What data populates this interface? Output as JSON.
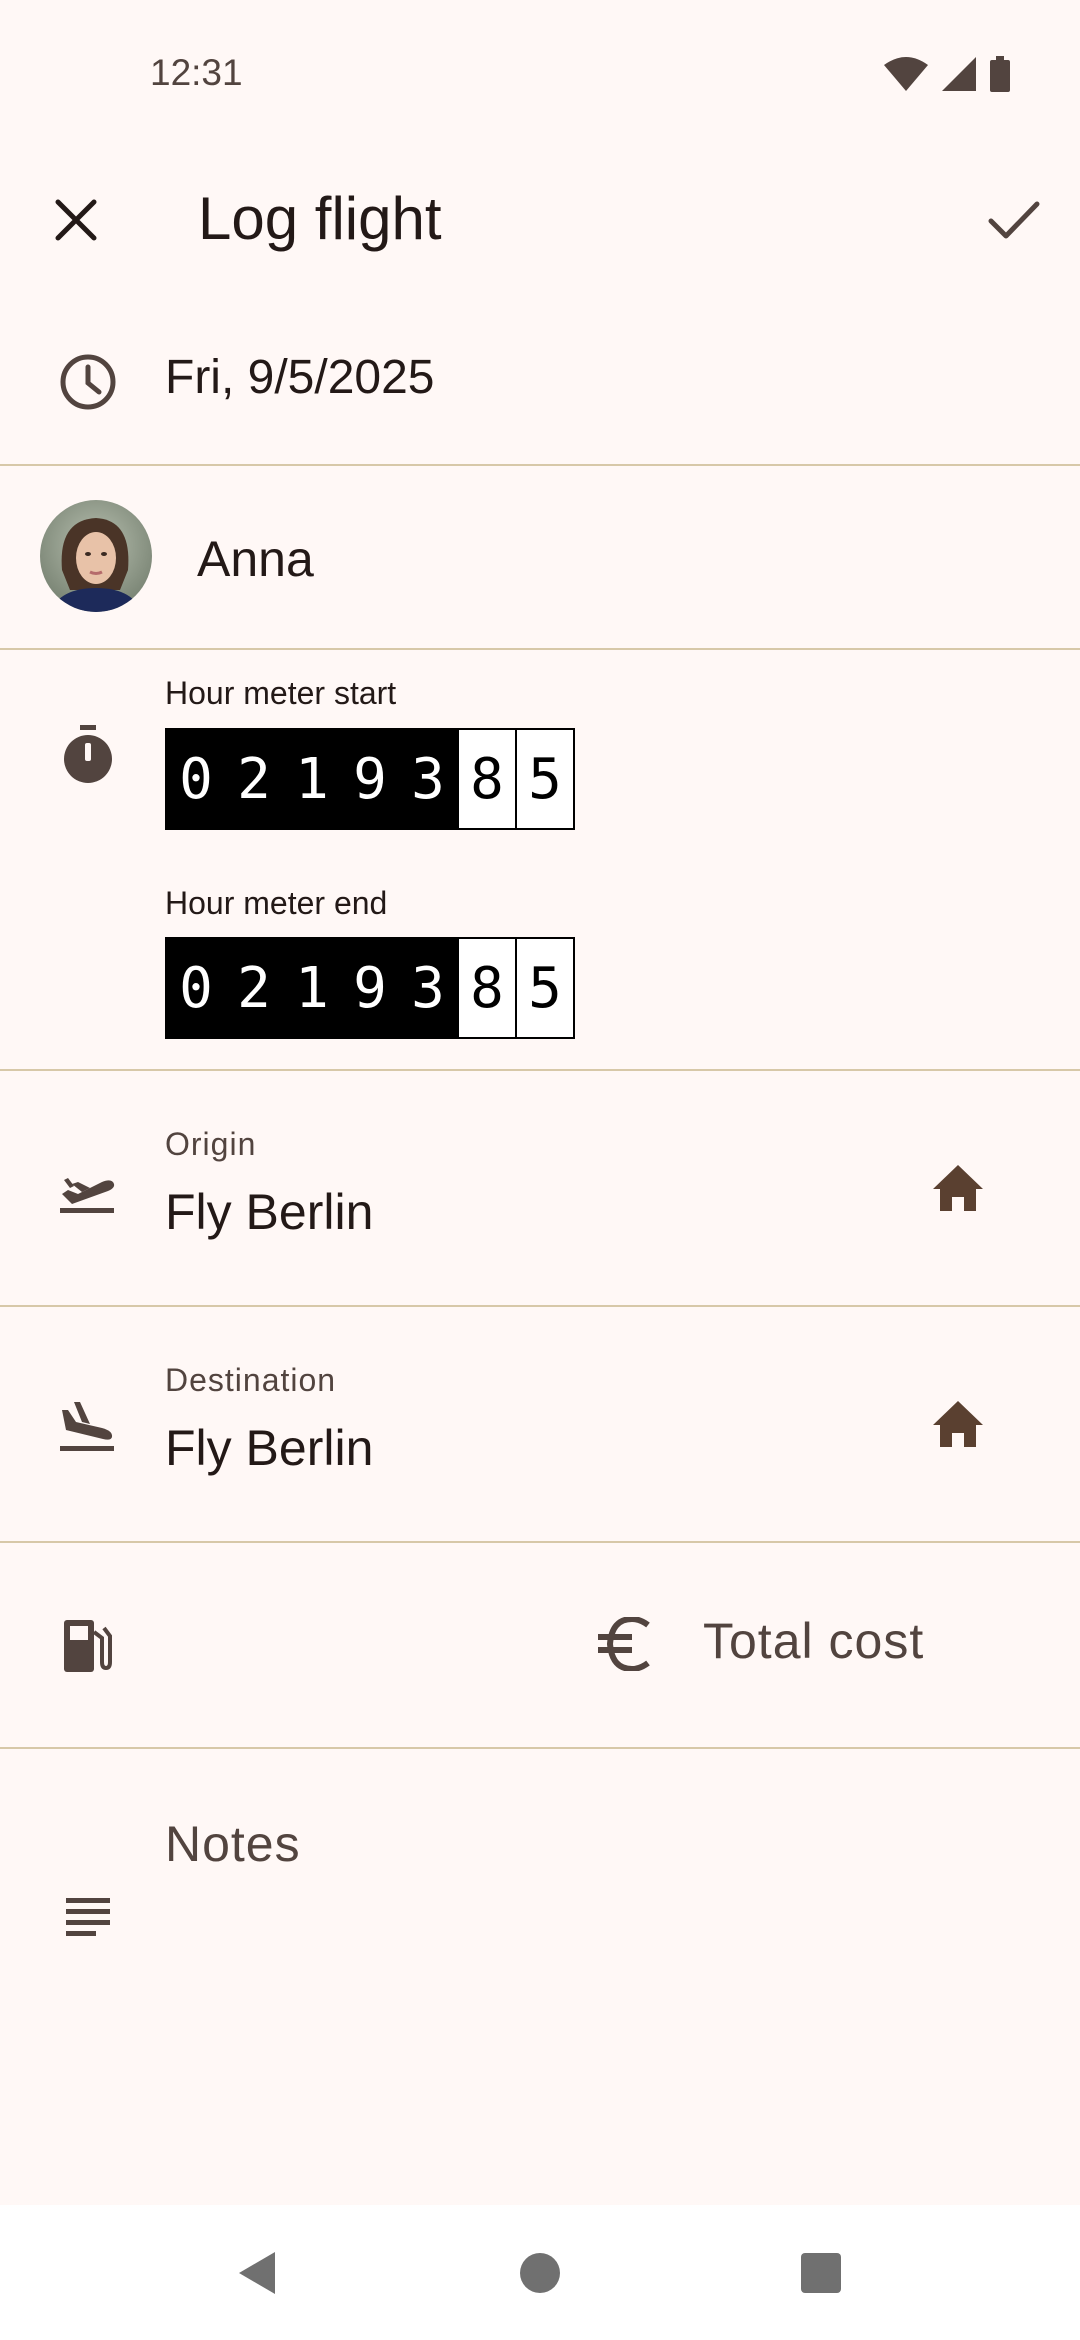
{
  "status_bar": {
    "time": "12:31",
    "icons": [
      "wifi-icon",
      "cellular-signal-icon",
      "battery-icon"
    ]
  },
  "app_bar": {
    "title": "Log flight",
    "close_icon": "close-icon",
    "confirm_icon": "check-icon"
  },
  "date_row": {
    "icon": "clock-icon",
    "value": "Fri, 9/5/2025"
  },
  "pilot_row": {
    "name": "Anna"
  },
  "hour_meter": {
    "icon": "stopwatch-icon",
    "start": {
      "label": "Hour meter start",
      "digits": [
        "0",
        "2",
        "1",
        "9",
        "3",
        "8",
        "5"
      ]
    },
    "end": {
      "label": "Hour meter end",
      "digits": [
        "0",
        "2",
        "1",
        "9",
        "3",
        "8",
        "5"
      ]
    }
  },
  "origin": {
    "icon": "flight-takeoff-icon",
    "label": "Origin",
    "value": "Fly Berlin",
    "action_icon": "home-icon"
  },
  "destination": {
    "icon": "flight-land-icon",
    "label": "Destination",
    "value": "Fly Berlin",
    "action_icon": "home-icon"
  },
  "cost_row": {
    "fuel_icon": "fuel-icon",
    "currency_icon": "euro-icon",
    "total_cost_placeholder": "Total cost"
  },
  "notes": {
    "icon": "notes-icon",
    "placeholder": "Notes"
  },
  "nav_bar": {
    "buttons": [
      "back-icon",
      "home-circle-icon",
      "recents-icon"
    ]
  },
  "colors": {
    "background": "#fff8f6",
    "divider": "#d7c8a8",
    "icon": "#52443f",
    "icon_dark": "#5a4030",
    "text": "#231917"
  }
}
